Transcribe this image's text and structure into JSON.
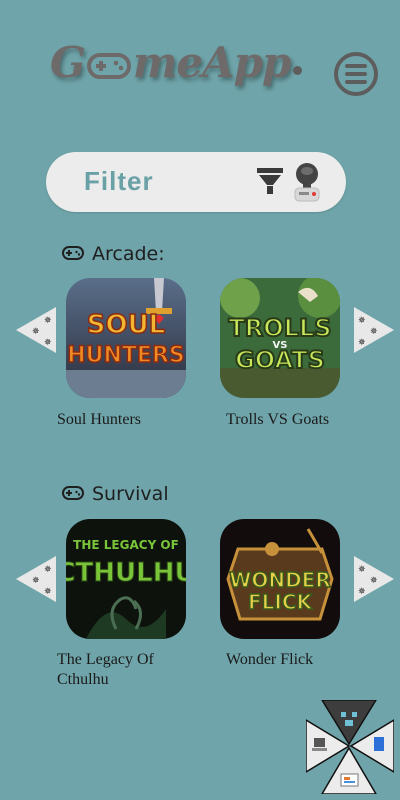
{
  "header": {
    "logo_text_left": "G",
    "logo_text_right": "meApp",
    "logo_icon": "gamepad-icon",
    "menu_icon": "hamburger-menu-icon"
  },
  "filter": {
    "label": "Filter",
    "funnel_icon": "funnel-icon",
    "robot_icon": "robot-icon"
  },
  "sections": [
    {
      "title": "Arcade:",
      "icon": "gamepad-icon",
      "games": [
        {
          "title": "Soul Hunters",
          "art_text": [
            "SOUL",
            "HUNTERS"
          ]
        },
        {
          "title": "Trolls VS Goats",
          "art_text": [
            "TROLLS",
            "VS",
            "GOATS"
          ]
        }
      ]
    },
    {
      "title": "Survival",
      "icon": "gamepad-icon",
      "games": [
        {
          "title": "The Legacy Of Cthulhu",
          "art_text": [
            "THE LEGACY OF",
            "CTHULHU"
          ]
        },
        {
          "title": "Wonder Flick",
          "art_text": [
            "WONDER",
            "FLICK"
          ]
        }
      ]
    }
  ],
  "colors": {
    "background": "#6fa5aa",
    "filter_bg": "#ececec",
    "filter_text": "#6aa1a6",
    "logo": "#6f6a6a"
  }
}
